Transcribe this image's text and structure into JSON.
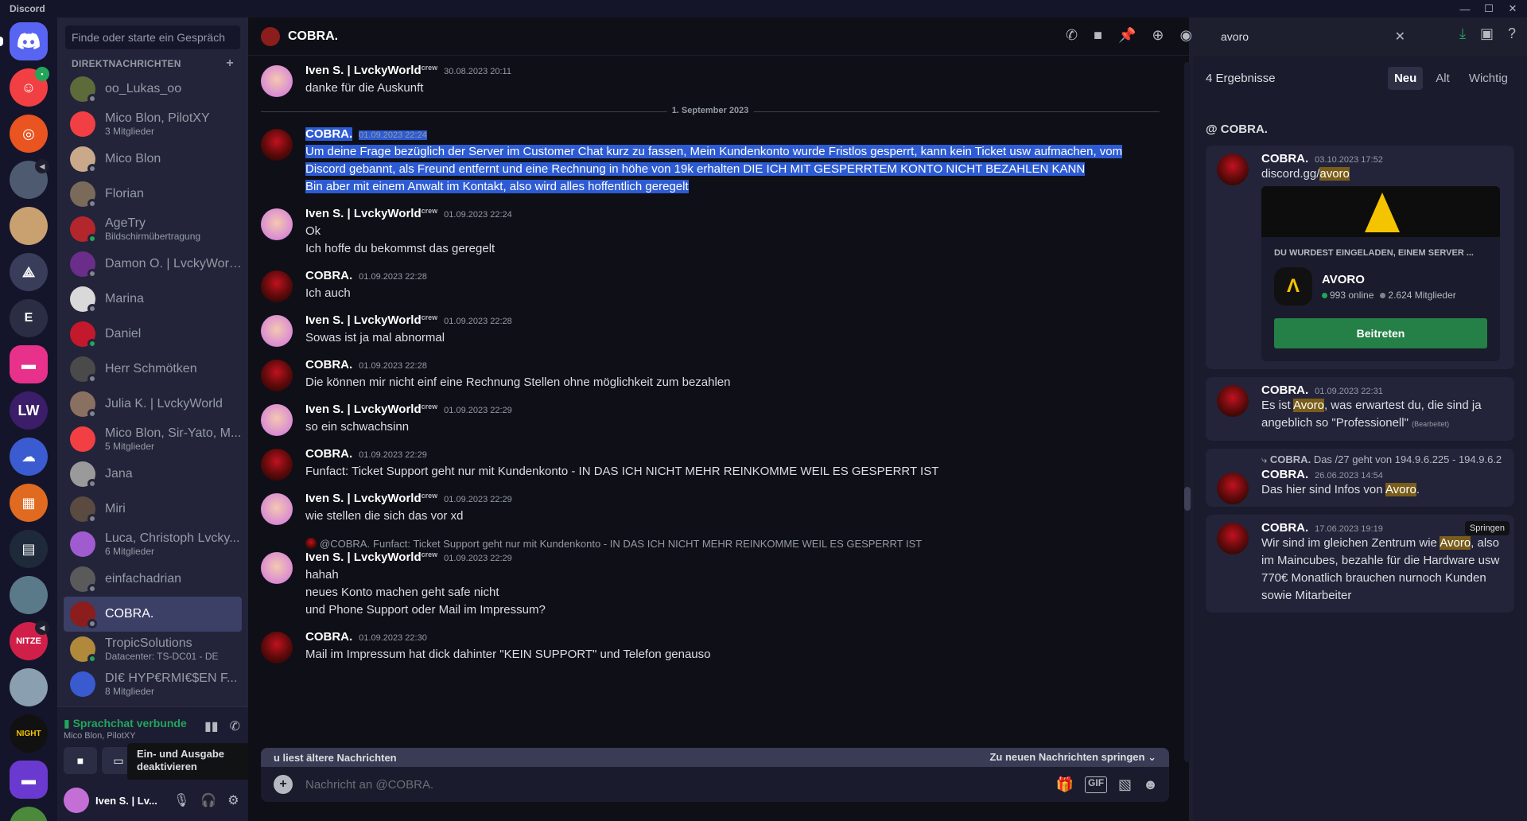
{
  "window": {
    "title": "Discord"
  },
  "sidebar": {
    "search_placeholder": "Finde oder starte ein Gespräch",
    "section_label": "DIREKTNACHRICHTEN",
    "dms": [
      {
        "name": "oo_Lukas_oo",
        "sub": "",
        "color": "#5d6b3a",
        "online": false
      },
      {
        "name": "Mico Blon, PilotXY",
        "sub": "3 Mitglieder",
        "color": "#f23f43",
        "online": false
      },
      {
        "name": "Mico Blon",
        "sub": "",
        "color": "#c9a98a",
        "online": false
      },
      {
        "name": "Florian",
        "sub": "",
        "color": "#7a6a5a",
        "online": false
      },
      {
        "name": "AgeTry",
        "sub": "Bildschirmübertragung",
        "color": "#b3262c",
        "online": true
      },
      {
        "name": "Damon O. | LvckyWorl...",
        "sub": "",
        "color": "#6b2d8a",
        "online": false
      },
      {
        "name": "Marina",
        "sub": "",
        "color": "#d9d9d9",
        "online": false
      },
      {
        "name": "Daniel",
        "sub": "",
        "color": "#c4182c",
        "online": true
      },
      {
        "name": "Herr Schmötken",
        "sub": "",
        "color": "#4a4a4a",
        "online": false
      },
      {
        "name": "Julia K. | LvckyWorld",
        "sub": "",
        "color": "#8a7060",
        "online": false
      },
      {
        "name": "Mico Blon, Sir-Yato, M...",
        "sub": "5 Mitglieder",
        "color": "#f23f43",
        "online": false
      },
      {
        "name": "Jana",
        "sub": "",
        "color": "#9a9a9a",
        "online": false
      },
      {
        "name": "Miri",
        "sub": "",
        "color": "#5a4a40",
        "online": false
      },
      {
        "name": "Luca, Christoph Lvcky...",
        "sub": "6 Mitglieder",
        "color": "#a05bd0",
        "online": false
      },
      {
        "name": "einfachadrian",
        "sub": "",
        "color": "#5a5a5a",
        "online": false
      },
      {
        "name": "COBRA.",
        "sub": "",
        "color": "#8b1d1d",
        "online": false
      },
      {
        "name": "TropicSolutions",
        "sub": "Datacenter: TS-DC01 - DE",
        "color": "#b08a3a",
        "online": true
      },
      {
        "name": "DI€ HYP€RMI€$EN F...",
        "sub": "8 Mitglieder",
        "color": "#3a5ad0",
        "online": false
      }
    ],
    "crew_tag": "crew"
  },
  "voice": {
    "status": "Sprachchat verbunde",
    "channel": "Mico Blon, PilotXY",
    "tooltip": "Ein- und Ausgabe deaktivieren"
  },
  "user": {
    "name": "Iven S. | Lv..."
  },
  "chat": {
    "title": "COBRA.",
    "date_divider": "1. September 2023",
    "older_notice": "u liest ältere Nachrichten",
    "jump_new": "Zu neuen Nachrichten springen",
    "composer_placeholder": "Nachricht an @COBRA.",
    "messages": [
      {
        "author": "Iven S. | LvckyWorld",
        "crew": "crew",
        "ts": "30.08.2023 20:11",
        "lines": [
          "danke für die Auskunft"
        ]
      },
      {
        "author": "COBRA.",
        "ts": "01.09.2023 22:24",
        "lines": [
          "Um deine Frage bezüglich der Server im Customer Chat kurz zu fassen, Mein Kundenkonto wurde Fristlos gesperrt, kann kein Ticket usw aufmachen, vom",
          "Discord gebannt, als Freund entfernt und eine Rechnung in höhe von 19k erhalten DIE ICH MIT GESPERRTEM KONTO NICHT BEZAHLEN KANN",
          "Bin aber mit einem Anwalt im Kontakt, also wird alles hoffentlich geregelt"
        ]
      },
      {
        "author": "Iven S. | LvckyWorld",
        "crew": "crew",
        "ts": "01.09.2023 22:24",
        "lines": [
          "Ok",
          "Ich hoffe du bekommst das geregelt"
        ]
      },
      {
        "author": "COBRA.",
        "ts": "01.09.2023 22:28",
        "lines": [
          "Ich auch"
        ]
      },
      {
        "author": "Iven S. | LvckyWorld",
        "crew": "crew",
        "ts": "01.09.2023 22:28",
        "lines": [
          "Sowas ist ja mal abnormal"
        ]
      },
      {
        "author": "COBRA.",
        "ts": "01.09.2023 22:28",
        "lines": [
          "Die können mir nicht einf eine Rechnung Stellen ohne möglichkeit zum bezahlen"
        ]
      },
      {
        "author": "Iven S. | LvckyWorld",
        "crew": "crew",
        "ts": "01.09.2023 22:29",
        "lines": [
          "so ein schwachsinn"
        ]
      },
      {
        "author": "COBRA.",
        "ts": "01.09.2023 22:29",
        "lines": [
          "Funfact: Ticket Support geht nur mit Kundenkonto - IN DAS ICH NICHT MEHR REINKOMME WEIL ES GESPERRT IST"
        ]
      },
      {
        "author": "Iven S. | LvckyWorld",
        "crew": "crew",
        "ts": "01.09.2023 22:29",
        "lines": [
          "wie stellen die sich das vor xd"
        ]
      },
      {
        "author": "Iven S. | LvckyWorld",
        "crew": "crew",
        "ts": "01.09.2023 22:29",
        "reply_to": "@COBRA.",
        "reply_text": "Funfact: Ticket Support geht nur mit Kundenkonto - IN DAS ICH NICHT MEHR REINKOMME WEIL ES GESPERRT IST",
        "lines": [
          "hahah",
          "neues Konto machen geht safe nicht",
          "und Phone Support oder Mail im Impressum?"
        ]
      },
      {
        "author": "COBRA.",
        "ts": "01.09.2023 22:30",
        "lines": [
          "Mail im Impressum hat dick dahinter \"KEIN SUPPORT\" und Telefon genauso"
        ]
      }
    ]
  },
  "search": {
    "query": "avoro",
    "results_count": "4 Ergebnisse",
    "sort_tabs": [
      "Neu",
      "Alt",
      "Wichtig"
    ],
    "channel_label": "@ COBRA.",
    "results": [
      {
        "author": "COBRA.",
        "ts": "03.10.2023 17:52",
        "text_prefix": "discord.gg/",
        "highlight": "avoro",
        "text_suffix": ""
      },
      {
        "author": "COBRA.",
        "ts": "01.09.2023 22:31",
        "text_prefix": "Es ist ",
        "highlight": "Avoro",
        "text_suffix": ", was erwartest du, die sind ja angeblich so \"Professionell\"",
        "edited": "(Bearbeitet)"
      },
      {
        "author": "COBRA.",
        "ts": "26.06.2023 14:54",
        "reply_author": "COBRA.",
        "reply_text": "Das /27 geht von 194.9.6.225 - 194.9.6.2",
        "text_prefix": "Das hier sind Infos von ",
        "highlight": "Avoro",
        "text_suffix": "."
      },
      {
        "author": "COBRA.",
        "ts": "17.06.2023 19:19",
        "text_prefix": "Wir sind im gleichen Zentrum wie ",
        "highlight": "Avoro",
        "text_suffix": ", also im Maincubes, bezahle für die Hardware usw 770€ Monatlich brauchen nurnoch Kunden sowie Mitarbeiter",
        "jump": "Springen"
      }
    ],
    "invite": {
      "title": "DU WURDEST EINGELADEN, EINEM SERVER ...",
      "server_name": "AVORO",
      "online": "993 online",
      "members": "2.624 Mitglieder",
      "join_label": "Beitreten"
    }
  }
}
